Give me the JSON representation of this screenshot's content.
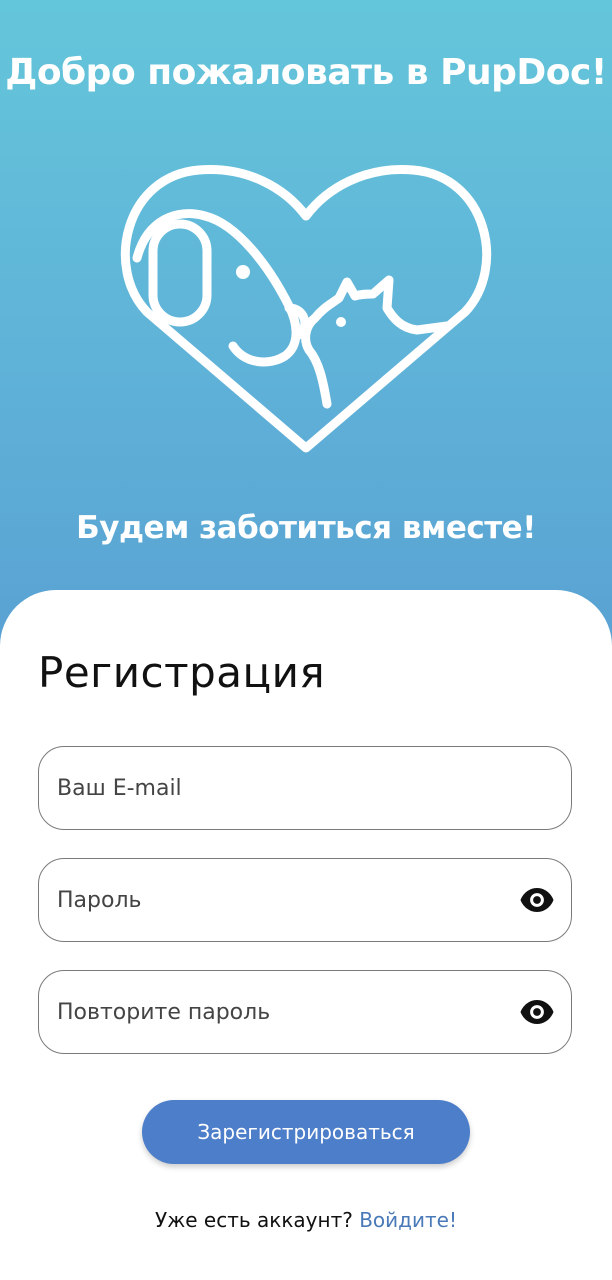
{
  "hero": {
    "welcome_text": "Добро пожаловать в PupDoc!",
    "tagline": "Будем заботиться вместе!",
    "logo_icon": "heart-dog-cat-icon",
    "gradient_top": "#64c6da",
    "gradient_bottom": "#59a1d3"
  },
  "form": {
    "title": "Регистрация",
    "email": {
      "placeholder": "Ваш E-mail",
      "value": ""
    },
    "password": {
      "placeholder": "Пароль",
      "value": "",
      "toggle_icon": "eye-icon"
    },
    "password_repeat": {
      "placeholder": "Повторите пароль",
      "value": "",
      "toggle_icon": "eye-icon"
    },
    "submit_label": "Зарегистрироваться",
    "submit_color": "#4d7ec9"
  },
  "footer": {
    "question": "Уже есть аккаунт?",
    "login_link": "Войдите!",
    "link_color": "#4a79b8"
  }
}
